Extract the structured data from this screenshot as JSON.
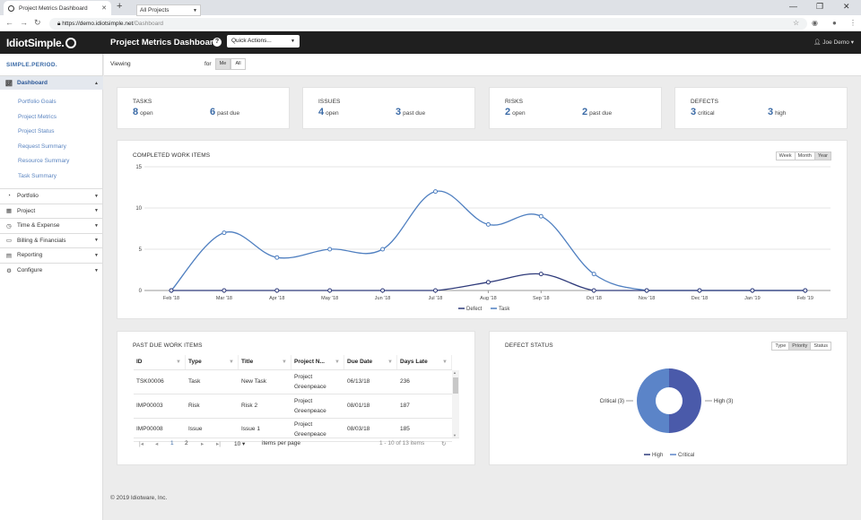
{
  "browser": {
    "tab_title": "Project Metrics Dashboard",
    "url_host": "https://demo.idiotsimple.net",
    "url_path": "/Dashboard"
  },
  "app": {
    "logo": "IdiotSimple.",
    "tagline": "SIMPLE.PERIOD.",
    "page_title": "Project Metrics Dashboard",
    "help_icon": "?",
    "quick_actions": "Quick Actions...",
    "user": "Joe Demo"
  },
  "sidebar": {
    "active": {
      "label": "Dashboard",
      "icon": "line-chart-icon"
    },
    "subitems": [
      "Portfolio Goals",
      "Project Metrics",
      "Project Status",
      "Request Summary",
      "Resource Summary",
      "Task Summary"
    ],
    "sections": [
      {
        "label": "Portfolio",
        "icon": "pie-chart-icon"
      },
      {
        "label": "Project",
        "icon": "calendar-icon"
      },
      {
        "label": "Time & Expense",
        "icon": "clock-icon"
      },
      {
        "label": "Billing & Financials",
        "icon": "credit-card-icon"
      },
      {
        "label": "Reporting",
        "icon": "report-icon"
      },
      {
        "label": "Configure",
        "icon": "gear-icon"
      }
    ]
  },
  "viewbar": {
    "viewing_label": "Viewing",
    "project_select": "All Projects",
    "for_label": "for",
    "me": "Me",
    "all": "All"
  },
  "summary": [
    {
      "title": "TASKS",
      "a_num": "8",
      "a_lbl": "open",
      "b_num": "6",
      "b_lbl": "past due"
    },
    {
      "title": "ISSUES",
      "a_num": "4",
      "a_lbl": "open",
      "b_num": "3",
      "b_lbl": "past due"
    },
    {
      "title": "RISKS",
      "a_num": "2",
      "a_lbl": "open",
      "b_num": "2",
      "b_lbl": "past due"
    },
    {
      "title": "DEFECTS",
      "a_num": "3",
      "a_lbl": "critical",
      "b_num": "3",
      "b_lbl": "high"
    }
  ],
  "completed": {
    "title": "COMPLETED WORK ITEMS",
    "ranges": [
      "Week",
      "Month",
      "Year"
    ],
    "selected_range": "Year"
  },
  "past_due": {
    "title": "PAST DUE WORK ITEMS",
    "columns": [
      "ID",
      "Type",
      "Title",
      "Project N...",
      "Due Date",
      "Days Late"
    ],
    "rows": [
      [
        "TSK00006",
        "Task",
        "New Task",
        "Project Greenpeace",
        "06/13/18",
        "236"
      ],
      [
        "IMP00003",
        "Risk",
        "Risk 2",
        "Project Greenpeace",
        "08/01/18",
        "187"
      ],
      [
        "IMP00008",
        "Issue",
        "Issue 1",
        "Project Greenpeace",
        "08/03/18",
        "185"
      ]
    ],
    "pages": [
      "1",
      "2"
    ],
    "page_size": "10",
    "items_per_page": "items per page",
    "range_text": "1 - 10 of 13 items"
  },
  "defect": {
    "title": "DEFECT STATUS",
    "views": [
      "Type",
      "Priority",
      "Status"
    ],
    "selected_view": "Priority"
  },
  "footer": "© 2019 Idiotware, Inc.",
  "colors": {
    "task": "#4f7fc0",
    "defect": "#2e3a7a",
    "accent": "#3a6aa6"
  },
  "chart_data": [
    {
      "type": "line",
      "categories": [
        "Feb '18",
        "Mar '18",
        "Apr '18",
        "May '18",
        "Jun '18",
        "Jul '18",
        "Aug '18",
        "Sep '18",
        "Oct '18",
        "Nov '18",
        "Dec '18",
        "Jan '19",
        "Feb '19"
      ],
      "series": [
        {
          "name": "Defect",
          "values": [
            0,
            0,
            0,
            0,
            0,
            0,
            1,
            2,
            0,
            0,
            0,
            0,
            0
          ]
        },
        {
          "name": "Task",
          "values": [
            0,
            7,
            4,
            5,
            5,
            12,
            8,
            9,
            2,
            0,
            0,
            0,
            0
          ]
        }
      ],
      "yticks": [
        0,
        5,
        10,
        15
      ],
      "ylim": [
        0,
        15
      ],
      "grid": true,
      "legend": "bottom"
    },
    {
      "type": "pie",
      "donut": true,
      "categories": [
        "High",
        "Critical"
      ],
      "values": [
        3,
        3
      ],
      "labels": [
        "High (3)",
        "Critical (3)"
      ],
      "legend": "bottom"
    }
  ]
}
